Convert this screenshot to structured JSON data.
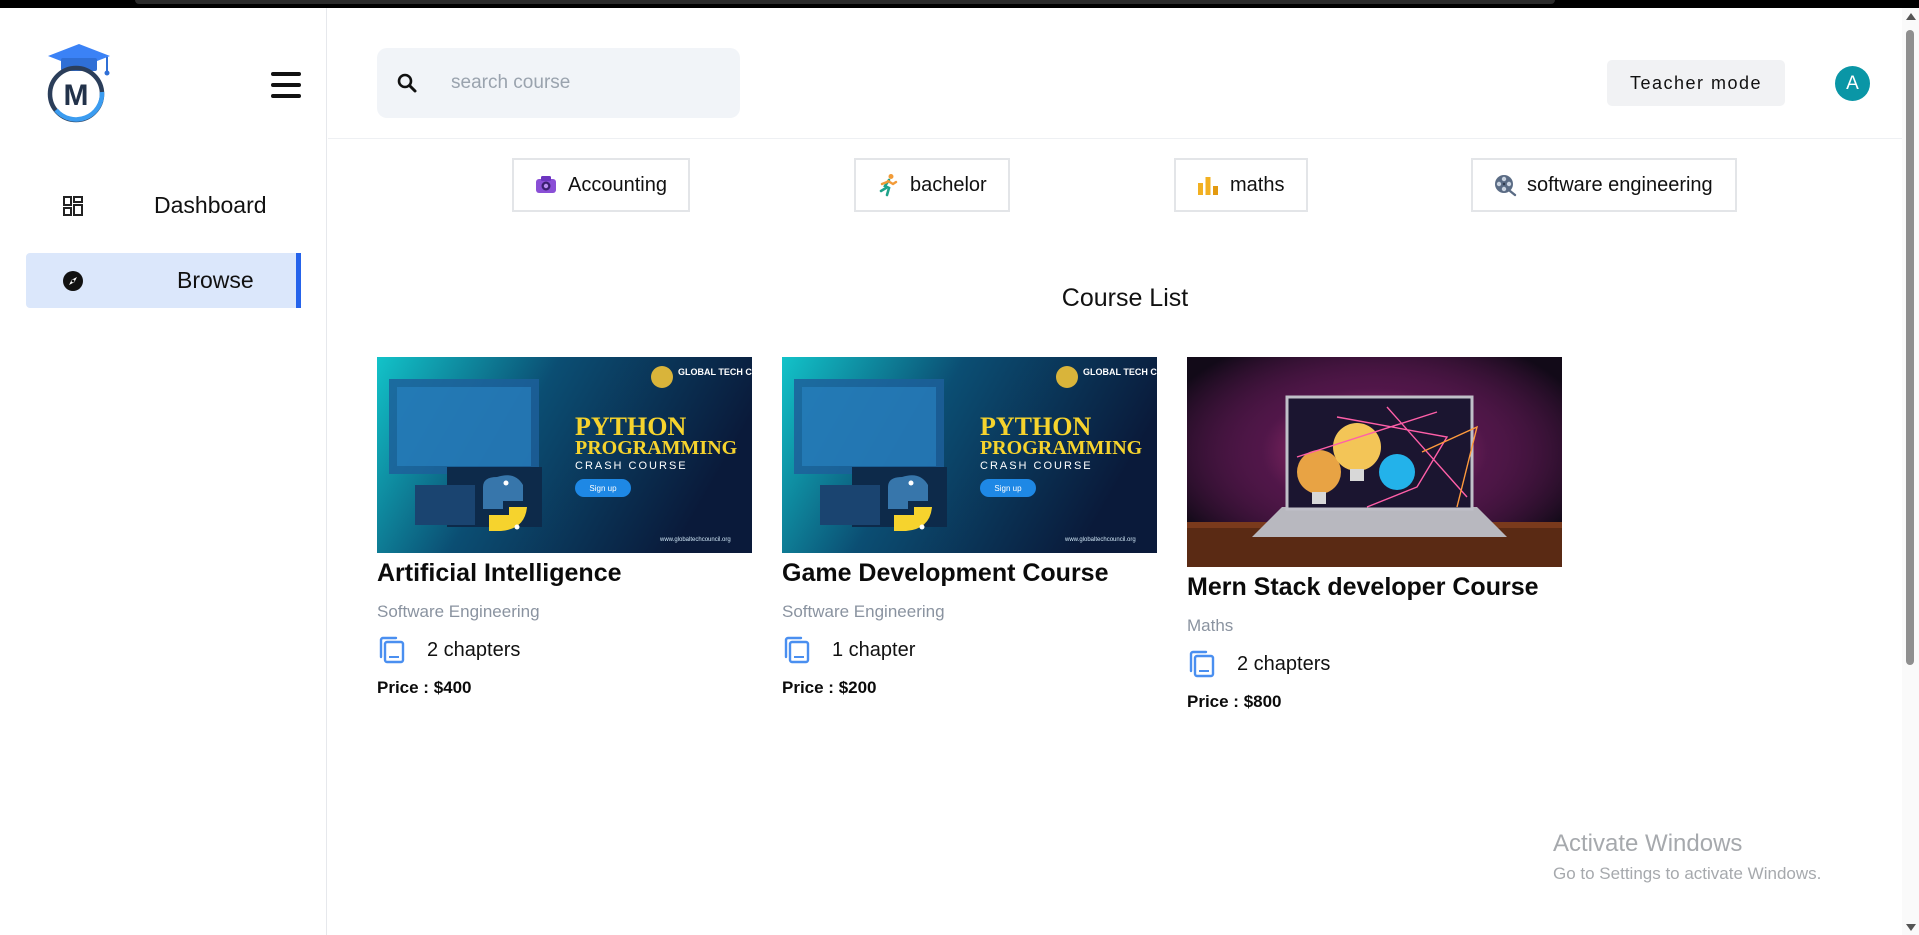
{
  "brand": {
    "logo_letter": "M"
  },
  "sidebar": {
    "items": [
      {
        "label": "Dashboard",
        "icon": "dashboard-grid-icon",
        "active": false
      },
      {
        "label": "Browse",
        "icon": "compass-icon",
        "active": true
      }
    ]
  },
  "search": {
    "placeholder": "search course",
    "value": ""
  },
  "header": {
    "teacher_mode_label": "Teacher mode",
    "avatar_initial": "A"
  },
  "categories": [
    {
      "label": "Accounting",
      "icon": "camera-icon"
    },
    {
      "label": "bachelor",
      "icon": "runner-icon"
    },
    {
      "label": "maths",
      "icon": "bar-chart-icon"
    },
    {
      "label": "software engineering",
      "icon": "film-reel-icon"
    }
  ],
  "course_list": {
    "title": "Course List",
    "courses": [
      {
        "title": "Artificial Intelligence",
        "category": "Software Engineering",
        "chapters": "2 chapters",
        "price": "Price : $400",
        "thumbnail": {
          "council": "GLOBAL TECH COUNCIL",
          "line1": "PYTHON",
          "line2": "PROGRAMMING",
          "line3": "CRASH COURSE",
          "cta": "Sign up",
          "url": "www.globaltechcouncil.org"
        }
      },
      {
        "title": "Game Development Course",
        "category": "Software Engineering",
        "chapters": "1 chapter",
        "price": "Price : $200",
        "thumbnail": {
          "council": "GLOBAL TECH COUNCIL",
          "line1": "PYTHON",
          "line2": "PROGRAMMING",
          "line3": "CRASH COURSE",
          "cta": "Sign up",
          "url": "www.globaltechcouncil.org"
        }
      },
      {
        "title": "Mern Stack developer Course",
        "category": "Maths",
        "chapters": "2 chapters",
        "price": "Price : $800"
      }
    ]
  },
  "watermark": {
    "line1": "Activate Windows",
    "line2": "Go to Settings to activate Windows."
  },
  "colors": {
    "accent": "#2563eb",
    "active_bg": "#dbe7fb",
    "avatar": "#0a96a6",
    "chapter_icon": "#4a8ff0",
    "muted_text": "#8a93a0"
  }
}
